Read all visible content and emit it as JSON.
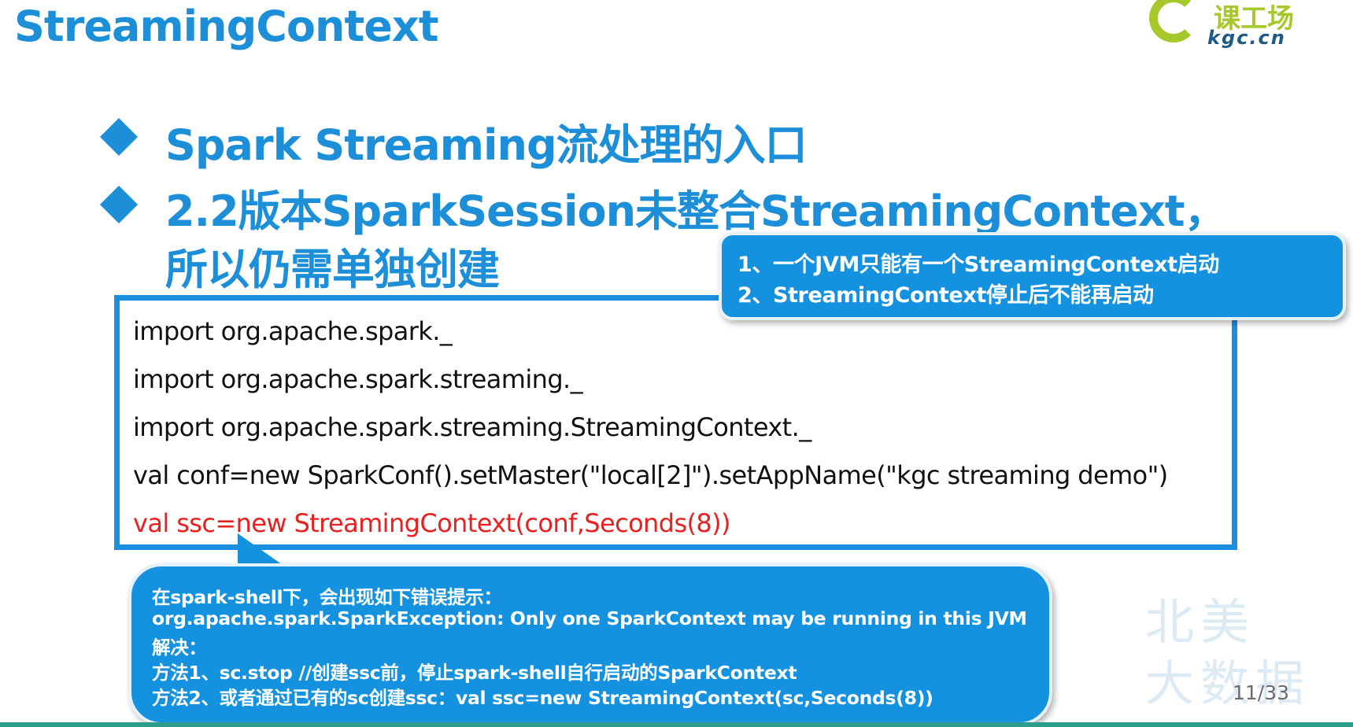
{
  "title": "StreamingContext",
  "logo": {
    "text": "课工场",
    "sub": "kgc.cn"
  },
  "bullets": [
    "Spark Streaming流处理的入口",
    "2.2版本SparkSession未整合StreamingContext，",
    "所以仍需单独创建"
  ],
  "code": [
    "import org.apache.spark._",
    "import org.apache.spark.streaming._",
    "import org.apache.spark.streaming.StreamingContext._",
    "val conf=new SparkConf().setMaster(\"local[2]\").setAppName(\"kgc streaming demo\")",
    "val ssc=new StreamingContext(conf,Seconds(8))"
  ],
  "callout_top": [
    "1、一个JVM只能有一个StreamingContext启动",
    "2、StreamingContext停止后不能再启动"
  ],
  "callout_bottom": [
    "在spark-shell下，会出现如下错误提示：",
    "org.apache.spark.SparkException: Only one SparkContext may be running in this JVM",
    "解决：",
    "方法1、sc.stop    //创建ssc前，停止spark-shell自行启动的SparkContext",
    "方法2、或者通过已有的sc创建ssc：val ssc=new StreamingContext(sc,Seconds(8))"
  ],
  "watermark": [
    "北美",
    "大数据"
  ],
  "page_number": "11/33",
  "colors": {
    "accent": "#1d8fd8",
    "code_highlight": "#e8201f",
    "logo_green": "#a6c82a"
  }
}
